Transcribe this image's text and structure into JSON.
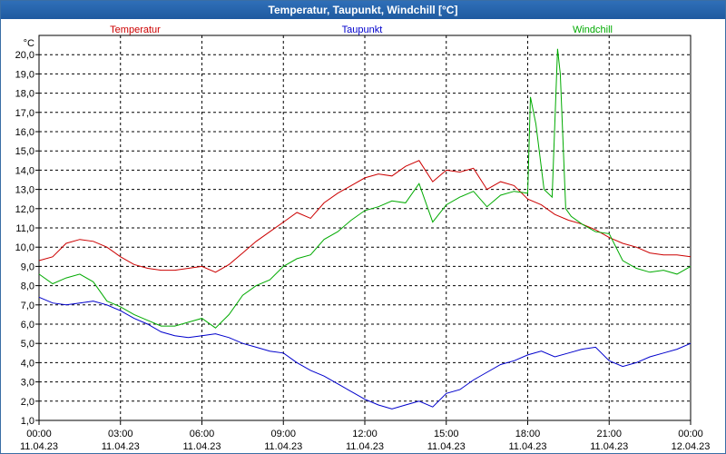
{
  "window": {
    "title": "Temperatur, Taupunkt, Windchill [°C]"
  },
  "chart_data": {
    "type": "line",
    "title": "Temperatur, Taupunkt, Windchill [°C]",
    "ylabel": "°C",
    "ylim": [
      1.0,
      21.0
    ],
    "yticks": [
      "1,0",
      "2,0",
      "3,0",
      "4,0",
      "5,0",
      "6,0",
      "7,0",
      "8,0",
      "9,0",
      "10,0",
      "11,0",
      "12,0",
      "13,0",
      "14,0",
      "15,0",
      "16,0",
      "17,0",
      "18,0",
      "19,0",
      "20,0"
    ],
    "xlim": [
      0,
      24
    ],
    "xticks": [
      {
        "time": "00:00",
        "date": "11.04.23"
      },
      {
        "time": "03:00",
        "date": "11.04.23"
      },
      {
        "time": "06:00",
        "date": "11.04.23"
      },
      {
        "time": "09:00",
        "date": "11.04.23"
      },
      {
        "time": "12:00",
        "date": "11.04.23"
      },
      {
        "time": "15:00",
        "date": "11.04.23"
      },
      {
        "time": "18:00",
        "date": "11.04.23"
      },
      {
        "time": "21:00",
        "date": "11.04.23"
      },
      {
        "time": "00:00",
        "date": "12.04.23"
      }
    ],
    "series": [
      {
        "name": "Temperatur",
        "color": "#cc0000",
        "x": [
          0,
          0.5,
          1,
          1.5,
          2,
          2.5,
          3,
          3.5,
          4,
          4.5,
          5,
          5.5,
          6,
          6.5,
          7,
          7.5,
          8,
          8.5,
          9,
          9.5,
          10,
          10.5,
          11,
          11.5,
          12,
          12.5,
          13,
          13.5,
          14,
          14.5,
          15,
          15.5,
          16,
          16.5,
          17,
          17.5,
          18,
          18.5,
          19,
          19.5,
          20,
          20.5,
          21,
          21.5,
          22,
          22.5,
          23,
          23.5,
          24
        ],
        "values": [
          9.3,
          9.5,
          10.2,
          10.4,
          10.3,
          10.0,
          9.5,
          9.1,
          8.9,
          8.8,
          8.8,
          8.9,
          9.0,
          8.7,
          9.1,
          9.7,
          10.3,
          10.8,
          11.3,
          11.8,
          11.5,
          12.3,
          12.8,
          13.2,
          13.6,
          13.8,
          13.7,
          14.2,
          14.5,
          13.4,
          14.0,
          13.9,
          14.1,
          13.0,
          13.4,
          13.2,
          12.5,
          12.2,
          11.7,
          11.4,
          11.2,
          10.9,
          10.5,
          10.2,
          10.0,
          9.7,
          9.6,
          9.6,
          9.5
        ]
      },
      {
        "name": "Taupunkt",
        "color": "#0000cc",
        "x": [
          0,
          0.5,
          1,
          1.5,
          2,
          2.5,
          3,
          3.5,
          4,
          4.5,
          5,
          5.5,
          6,
          6.5,
          7,
          7.5,
          8,
          8.5,
          9,
          9.5,
          10,
          10.5,
          11,
          11.5,
          12,
          12.5,
          13,
          13.5,
          14,
          14.5,
          15,
          15.5,
          16,
          16.5,
          17,
          17.5,
          18,
          18.5,
          19,
          19.5,
          20,
          20.5,
          21,
          21.5,
          22,
          22.5,
          23,
          23.5,
          24
        ],
        "values": [
          7.4,
          7.1,
          7.0,
          7.1,
          7.2,
          7.0,
          6.7,
          6.3,
          6.0,
          5.6,
          5.4,
          5.3,
          5.4,
          5.5,
          5.3,
          5.0,
          4.8,
          4.6,
          4.5,
          4.0,
          3.6,
          3.3,
          2.9,
          2.5,
          2.1,
          1.8,
          1.6,
          1.8,
          2.0,
          1.7,
          2.4,
          2.6,
          3.1,
          3.5,
          3.9,
          4.1,
          4.4,
          4.6,
          4.3,
          4.5,
          4.7,
          4.8,
          4.1,
          3.8,
          4.0,
          4.3,
          4.5,
          4.7,
          5.0
        ]
      },
      {
        "name": "Windchill",
        "color": "#00aa00",
        "x": [
          0,
          0.5,
          1,
          1.5,
          2,
          2.5,
          3,
          3.5,
          4,
          4.5,
          5,
          5.5,
          6,
          6.5,
          7,
          7.5,
          8,
          8.5,
          9,
          9.5,
          10,
          10.5,
          11,
          11.5,
          12,
          12.5,
          13,
          13.5,
          14,
          14.5,
          15,
          15.5,
          16,
          16.5,
          17,
          17.5,
          18,
          18.1,
          18.3,
          18.6,
          18.9,
          19.1,
          19.2,
          19.4,
          19.6,
          20,
          20.5,
          21,
          21.5,
          22,
          22.5,
          23,
          23.5,
          24
        ],
        "values": [
          8.6,
          8.1,
          8.4,
          8.6,
          8.2,
          7.2,
          6.9,
          6.5,
          6.2,
          5.9,
          5.9,
          6.1,
          6.3,
          5.8,
          6.5,
          7.5,
          8.0,
          8.3,
          9.0,
          9.4,
          9.6,
          10.4,
          10.8,
          11.4,
          11.9,
          12.1,
          12.4,
          12.3,
          13.3,
          11.3,
          12.2,
          12.6,
          12.9,
          12.1,
          12.7,
          12.9,
          12.8,
          17.8,
          16.4,
          13.0,
          12.6,
          20.3,
          19.0,
          12.0,
          11.6,
          11.2,
          10.8,
          10.7,
          9.3,
          8.9,
          8.7,
          8.8,
          8.6,
          9.0
        ]
      }
    ],
    "grid": true,
    "legend": "top"
  }
}
